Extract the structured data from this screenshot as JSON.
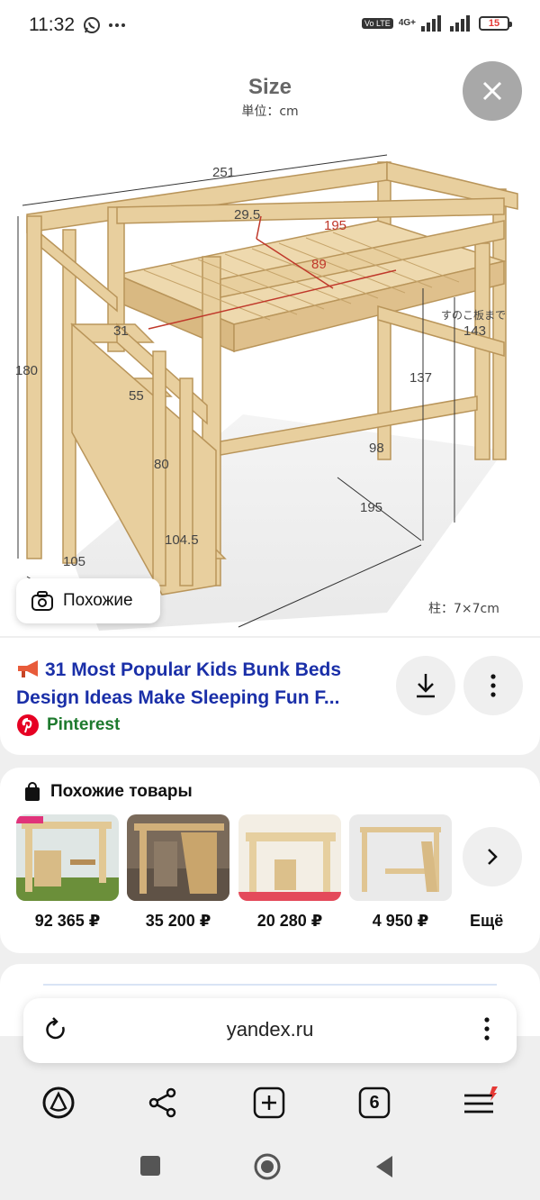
{
  "status": {
    "time": "11:32",
    "volte": "Vo LTE",
    "network": "4G+",
    "battery": "15"
  },
  "image": {
    "heading": "Size",
    "unit_label": "単位：cm",
    "dimensions": {
      "length": "251",
      "rail_height": "29.5",
      "mattress_length": "195",
      "mattress_width": "89",
      "step1": "31",
      "step2": "55",
      "step3": "80",
      "step4": "104.5",
      "total_height": "180",
      "depth": "105",
      "under_height": "137",
      "slat_label": "すのこ板まで",
      "slat_height": "143",
      "under_width": "98",
      "under_length": "195"
    },
    "post_note": "柱：7×7cm",
    "similar_label": "Похожие"
  },
  "result": {
    "title": "31 Most Popular Kids Bunk Beds Design Ideas Make Sleeping Fun F...",
    "source": "Pinterest"
  },
  "products": {
    "title": "Похожие товары",
    "items": [
      {
        "price": "92 365 ₽"
      },
      {
        "price": "35 200 ₽"
      },
      {
        "price": "20 280 ₽"
      },
      {
        "price": "4 950 ₽"
      }
    ],
    "more_label": "Ещё"
  },
  "browser": {
    "url": "yandex.ru",
    "tab_count": "6"
  },
  "colors": {
    "title_blue": "#1a2fa8",
    "source_green": "#1e7a2e",
    "pinterest_red": "#e60023",
    "wood": "#e6cc9a",
    "dimension_red": "#c0392b"
  }
}
